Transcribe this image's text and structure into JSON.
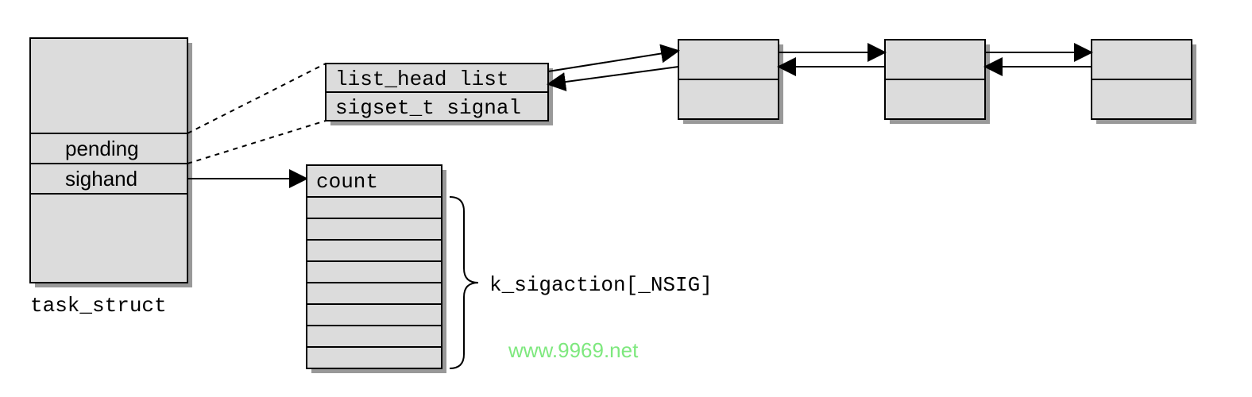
{
  "task_struct": {
    "label": "task_struct",
    "fields": {
      "pending": "pending",
      "sighand": "sighand"
    }
  },
  "pending_struct": {
    "list": "list_head list",
    "signal": "sigset_t signal"
  },
  "sighand_struct": {
    "count": "count",
    "array_label": "k_sigaction[_NSIG]"
  },
  "watermark": "www.9969.net"
}
